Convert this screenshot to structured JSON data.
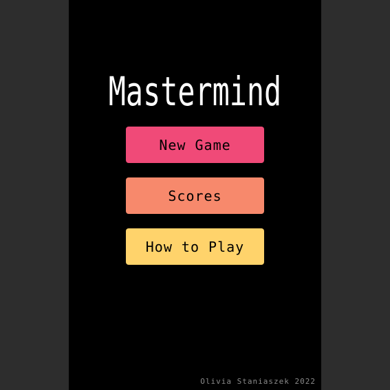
{
  "game": {
    "title": "Mastermind",
    "menu": {
      "new_game_label": "New Game",
      "scores_label": "Scores",
      "how_to_play_label": "How to Play"
    },
    "credit": "Olivia Staniaszek 2022"
  },
  "colors": {
    "background": "#000000",
    "side_panels": "#2d2d2d",
    "title_text": "#ffffff",
    "new_game_button": "#f04a78",
    "scores_button": "#f7896c",
    "how_to_play_button": "#ffd36b",
    "credit_text": "#8a8a8a"
  }
}
